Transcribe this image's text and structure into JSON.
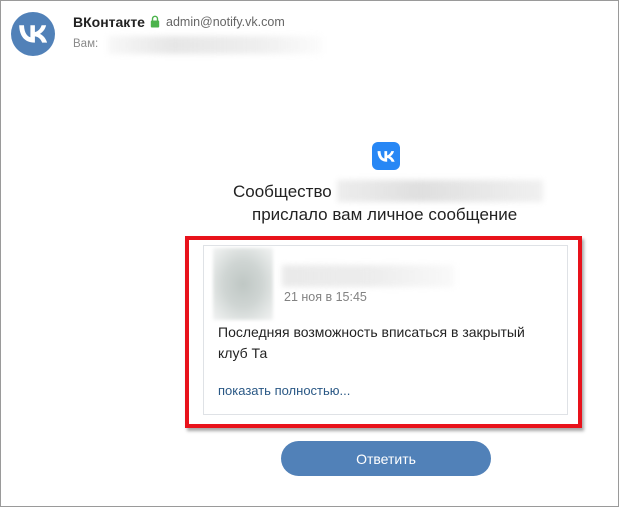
{
  "header": {
    "sender_name": "ВКонтакте",
    "sender_email": "admin@notify.vk.com",
    "to_label": "Вам:"
  },
  "message": {
    "headline_prefix": "Сообщество",
    "headline_suffix": "прислало вам личное сообщение",
    "date": "21 ноя в 15:45",
    "text": "Последняя возможность вписаться в закрытый клуб Та",
    "show_more": "показать полностью..."
  },
  "actions": {
    "reply_label": "Ответить"
  },
  "colors": {
    "vk_blue": "#5181b8",
    "vk_bright_blue": "#2787f5",
    "highlight_red": "#e8121b",
    "link_blue": "#2a5885",
    "lock_green": "#4bb34b"
  },
  "icons": {
    "sender_avatar": "vk-logo-icon",
    "security": "lock-icon",
    "center_logo": "vk-logo-icon"
  }
}
